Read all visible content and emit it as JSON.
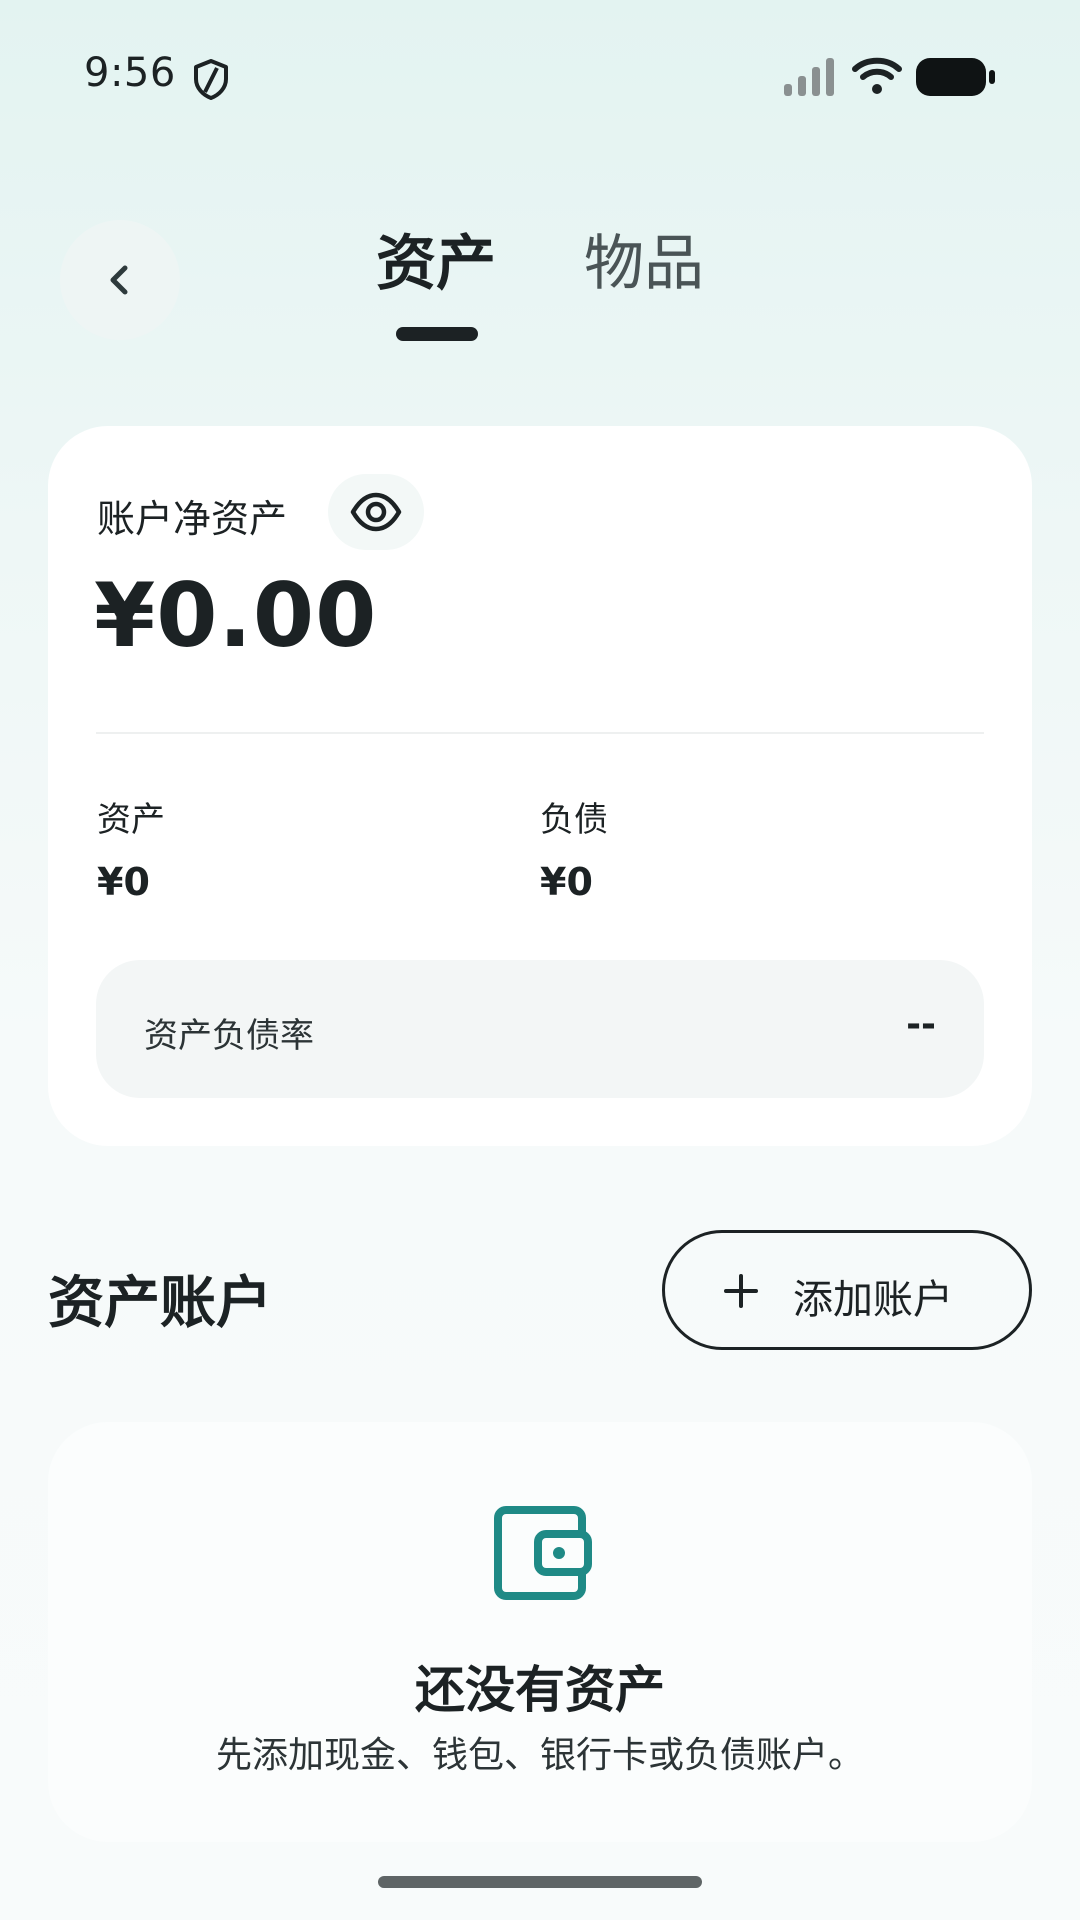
{
  "status_bar": {
    "time": "9:56",
    "icons": [
      "shield-icon",
      "signal-icon",
      "wifi-icon",
      "battery-icon"
    ]
  },
  "header": {
    "back_icon": "chevron-left-icon",
    "tabs": [
      {
        "label": "资产",
        "active": true
      },
      {
        "label": "物品",
        "active": false
      }
    ]
  },
  "summary": {
    "net_assets_label": "账户净资产",
    "visibility_icon": "eye-icon",
    "net_assets_value": "¥0.00",
    "assets_label": "资产",
    "assets_value": "¥0",
    "liabilities_label": "负债",
    "liabilities_value": "¥0",
    "ratio_label": "资产负债率",
    "ratio_value": "--"
  },
  "accounts_section": {
    "title": "资产账户",
    "add_button_label": "添加账户",
    "add_icon": "plus-icon"
  },
  "empty_state": {
    "icon": "wallet-icon",
    "title": "还没有资产",
    "description": "先添加现金、钱包、银行卡或负债账户。"
  },
  "colors": {
    "accent": "#1f8a86",
    "text": "#1c2224",
    "background_top": "#e3f3f1",
    "card": "#ffffff"
  }
}
